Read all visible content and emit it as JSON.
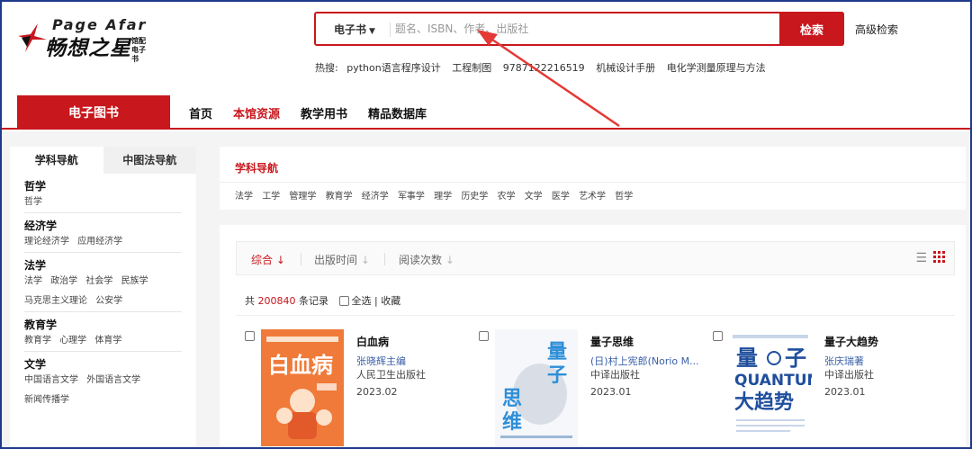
{
  "header": {
    "logo_en": "Page Afar",
    "logo_cn": "畅想之星",
    "logo_sub": "馆配 电子书",
    "search": {
      "type_label": "电子书",
      "placeholder": "题名、ISBN、作者、出版社",
      "button_label": "检索"
    },
    "advanced_search": "高级检索",
    "hot": {
      "label": "热搜:",
      "terms": [
        "python语言程序设计",
        "工程制图",
        "9787122216519",
        "机械设计手册",
        "电化学测量原理与方法"
      ]
    }
  },
  "nav": {
    "primary_tab": "电子图书",
    "items": [
      "首页",
      "本馆资源",
      "教学用书",
      "精品数据库"
    ],
    "active_item": "本馆资源"
  },
  "sidebar": {
    "tabs": [
      "学科导航",
      "中图法导航"
    ],
    "sections": [
      {
        "heading": "哲学",
        "links": [
          "哲学"
        ]
      },
      {
        "heading": "经济学",
        "links": [
          "理论经济学",
          "应用经济学"
        ]
      },
      {
        "heading": "法学",
        "links": [
          "法学",
          "政治学",
          "社会学",
          "民族学"
        ],
        "links2": [
          "马克思主义理论",
          "公安学"
        ]
      },
      {
        "heading": "教育学",
        "links": [
          "教育学",
          "心理学",
          "体育学"
        ]
      },
      {
        "heading": "文学",
        "links": [
          "中国语言文学",
          "外国语言文学"
        ],
        "links2": [
          "新闻传播学"
        ]
      }
    ]
  },
  "subject_nav": {
    "title": "学科导航",
    "links": [
      "法学",
      "工学",
      "管理学",
      "教育学",
      "经济学",
      "军事学",
      "理学",
      "历史学",
      "农学",
      "文学",
      "医学",
      "艺术学",
      "哲学"
    ]
  },
  "results": {
    "sort": {
      "options": [
        "综合",
        "出版时间",
        "阅读次数"
      ],
      "active": "综合",
      "arrow": "↓"
    },
    "count_prefix": "共",
    "count": "200840",
    "count_suffix": "条记录",
    "select_all": "全选 | 收藏",
    "books": [
      {
        "title": "白血病",
        "author": "张晓辉主编",
        "publisher": "人民卫生出版社",
        "date": "2023.02",
        "cover_text": "白血病"
      },
      {
        "title": "量子思维",
        "author": "(日)村上宪郎(Norio M...",
        "publisher": "中译出版社",
        "date": "2023.01",
        "cover_text": "量子思维"
      },
      {
        "title": "量子大趋势",
        "author": "张庆瑞著",
        "publisher": "中译出版社",
        "date": "2023.01",
        "cover_text": "量子 QUANTUM 大趋势"
      }
    ]
  },
  "colors": {
    "brand_red": "#c8171d",
    "link_blue": "#3a5fa8",
    "annotation_arrow": "#e53935"
  }
}
